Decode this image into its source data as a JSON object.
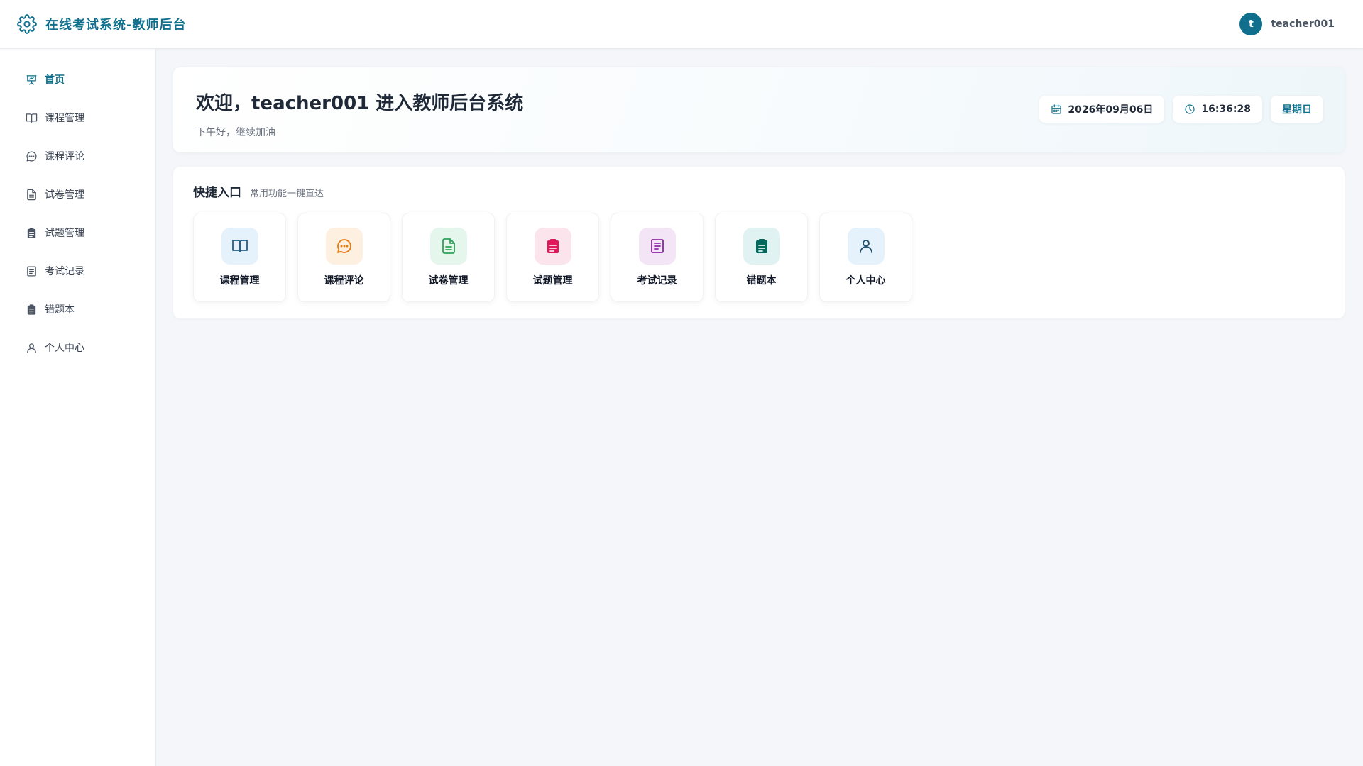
{
  "header": {
    "title": "在线考试系统-教师后台",
    "brand_icon": "gear-icon",
    "avatar_letter": "t",
    "username": "teacher001",
    "accent_color": "#0f6f8c"
  },
  "sidebar": {
    "items": [
      {
        "label": "首页",
        "icon": "presentation-icon",
        "active": true
      },
      {
        "label": "课程管理",
        "icon": "book-icon",
        "active": false
      },
      {
        "label": "课程评论",
        "icon": "comment-icon",
        "active": false
      },
      {
        "label": "试卷管理",
        "icon": "document-icon",
        "active": false
      },
      {
        "label": "试题管理",
        "icon": "clipboard-icon",
        "active": false
      },
      {
        "label": "考试记录",
        "icon": "record-icon",
        "active": false
      },
      {
        "label": "错题本",
        "icon": "clipboard-icon",
        "active": false
      },
      {
        "label": "个人中心",
        "icon": "user-icon",
        "active": false
      }
    ]
  },
  "welcome": {
    "title": "欢迎，teacher001 进入教师后台系统",
    "subtitle": "下午好，继续加油",
    "date": "2026年09月06日",
    "time": "16:36:28",
    "weekday": "星期日"
  },
  "quick": {
    "title": "快捷入口",
    "subtitle": "常用功能一键直达",
    "items": [
      {
        "label": "课程管理",
        "icon": "book-icon",
        "bg": "#e6f2fb",
        "fg": "#1f5f8b"
      },
      {
        "label": "课程评论",
        "icon": "comment-icon",
        "bg": "#fdf0e1",
        "fg": "#e07b12"
      },
      {
        "label": "试卷管理",
        "icon": "document-icon",
        "bg": "#e5f6ec",
        "fg": "#2ea35a"
      },
      {
        "label": "试题管理",
        "icon": "clipboard-icon",
        "bg": "#fbe4ec",
        "fg": "#e0195c"
      },
      {
        "label": "考试记录",
        "icon": "record-icon",
        "bg": "#f3e5f5",
        "fg": "#8e24aa"
      },
      {
        "label": "错题本",
        "icon": "clipboard-icon",
        "bg": "#e0f2f1",
        "fg": "#00695c"
      },
      {
        "label": "个人中心",
        "icon": "user-icon",
        "bg": "#e6f2fb",
        "fg": "#1f4f6b"
      }
    ]
  }
}
